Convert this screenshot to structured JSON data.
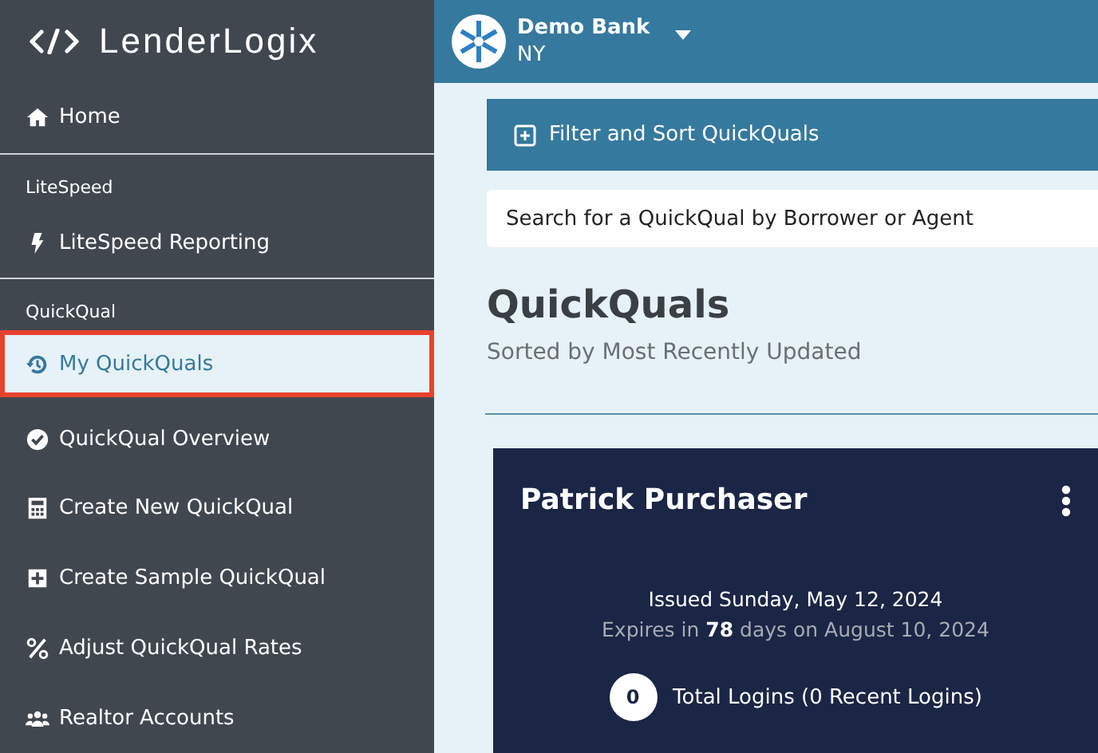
{
  "brand": {
    "name": "LenderLogix"
  },
  "sidebar": {
    "items": [
      {
        "kind": "link",
        "label": "Home",
        "selected": false
      },
      {
        "kind": "divider"
      },
      {
        "kind": "section",
        "label": "LiteSpeed"
      },
      {
        "kind": "link",
        "label": "LiteSpeed Reporting",
        "selected": false
      },
      {
        "kind": "divider"
      },
      {
        "kind": "section",
        "label": "QuickQual"
      },
      {
        "kind": "link",
        "label": "My QuickQuals",
        "selected": true
      },
      {
        "kind": "link",
        "label": "QuickQual Overview",
        "selected": false
      },
      {
        "kind": "link",
        "label": "Create New QuickQual",
        "selected": false
      },
      {
        "kind": "link",
        "label": "Create Sample QuickQual",
        "selected": false
      },
      {
        "kind": "link",
        "label": "Adjust QuickQual Rates",
        "selected": false
      },
      {
        "kind": "link",
        "label": "Realtor Accounts",
        "selected": false
      }
    ]
  },
  "header": {
    "bank": "Demo Bank",
    "state": "NY"
  },
  "filter": {
    "label": "Filter and Sort QuickQuals"
  },
  "search": {
    "placeholder": "Search for a QuickQual by Borrower or Agent"
  },
  "page": {
    "title": "QuickQuals",
    "subtitle": "Sorted by Most Recently Updated"
  },
  "card": {
    "name": "Patrick Purchaser",
    "issued": "Issued Sunday, May 12, 2024",
    "expires": "Expires in **78** days on August 10, 2024",
    "logins_count": "0",
    "logins_label": "Total Logins (0 Recent Logins)"
  }
}
